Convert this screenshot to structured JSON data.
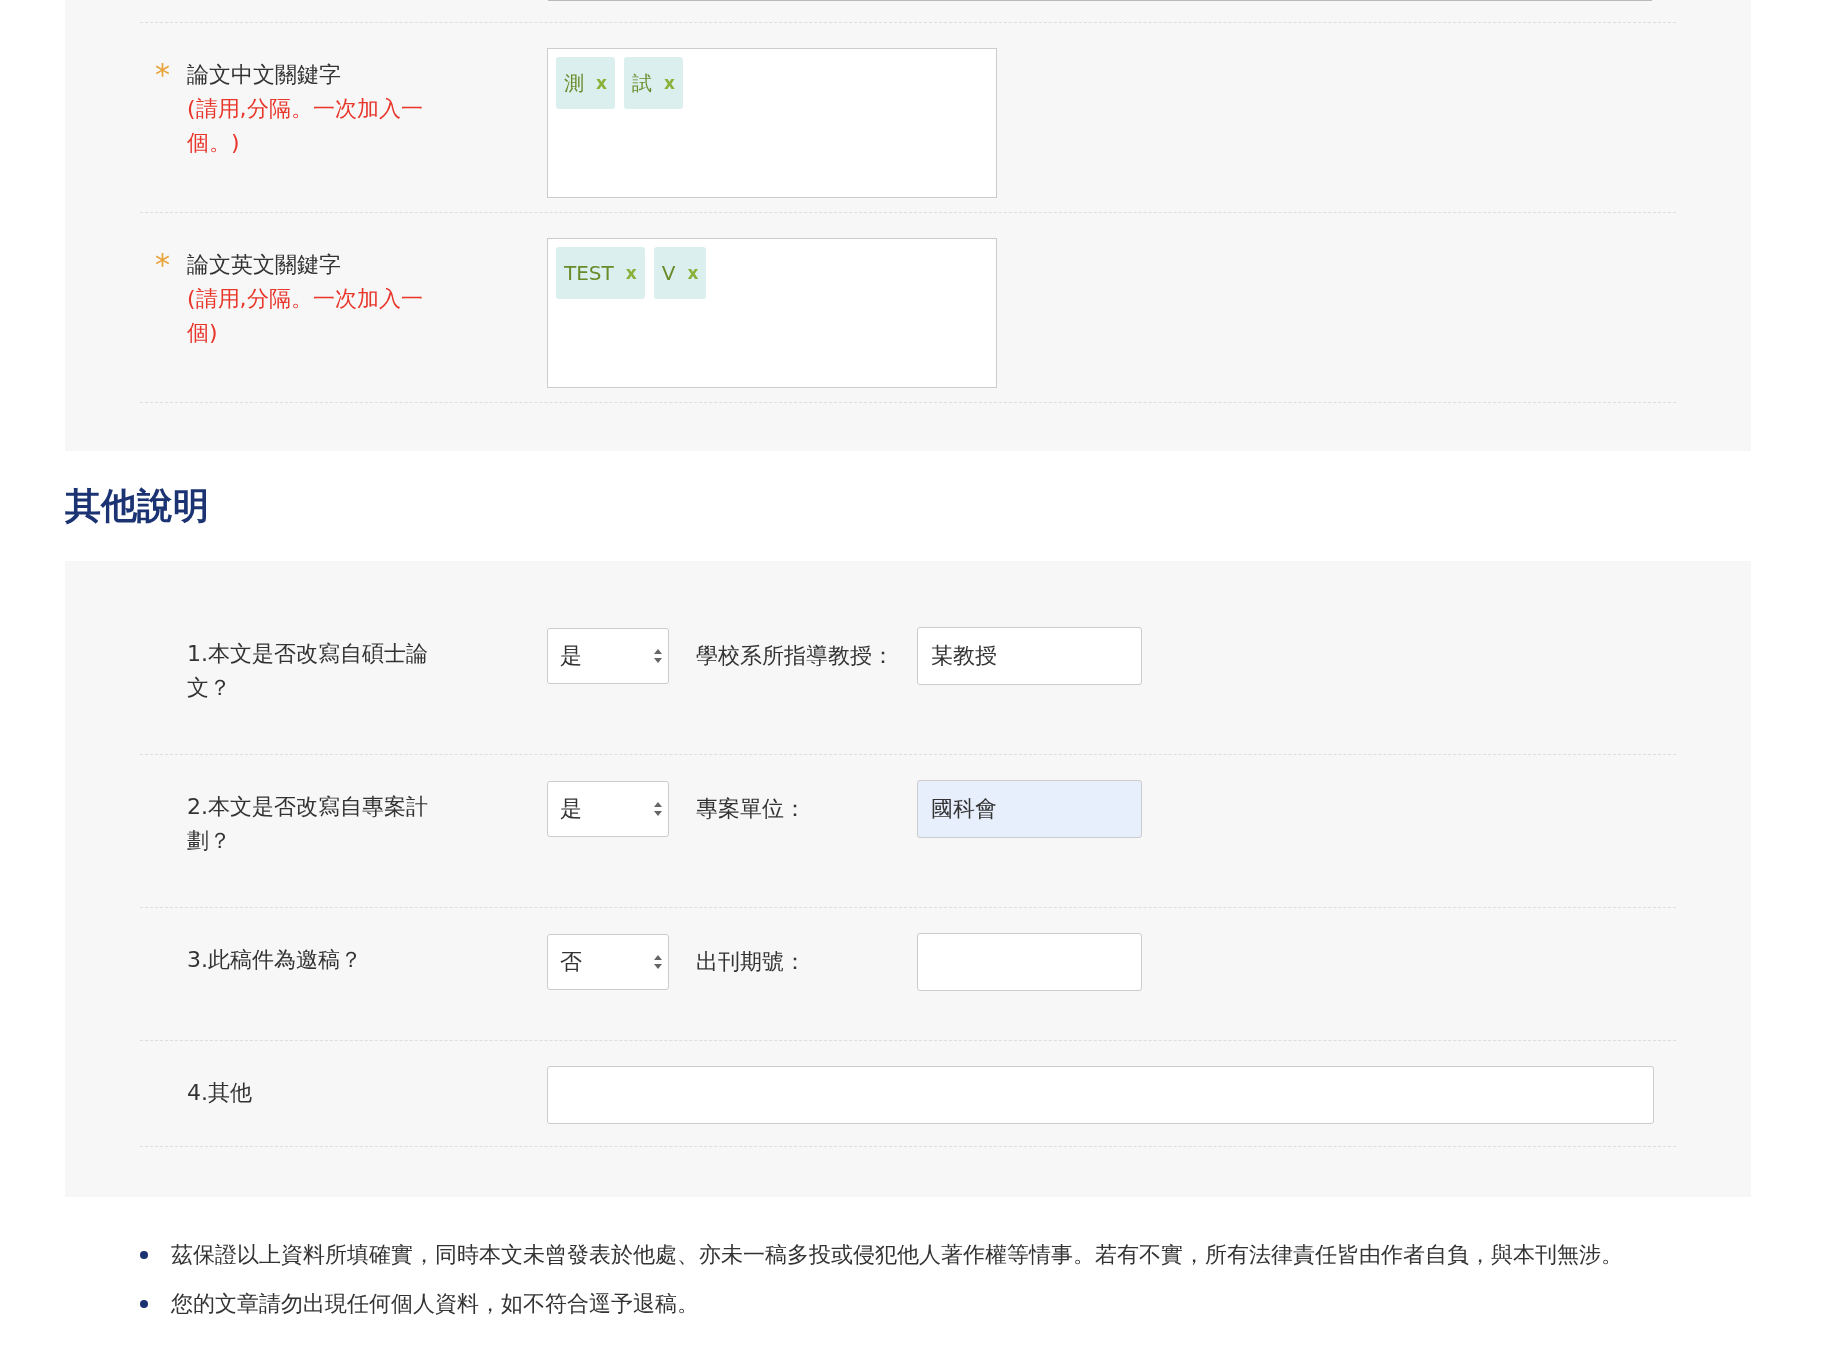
{
  "keyword_rows": [
    {
      "required": true,
      "required_mark": "*",
      "label": "論文中文關鍵字",
      "hint": "(請用,分隔。一次加入一個。)",
      "tags": [
        {
          "text": "測",
          "remove": "x"
        },
        {
          "text": "試",
          "remove": "x"
        }
      ]
    },
    {
      "required": true,
      "required_mark": "*",
      "label": "論文英文關鍵字",
      "hint": "(請用,分隔。一次加入一個)",
      "tags": [
        {
          "text": "TEST",
          "remove": "x"
        },
        {
          "text": "V",
          "remove": "x"
        }
      ]
    }
  ],
  "section_title": "其他說明",
  "question_rows": [
    {
      "kind": "select_input",
      "question": "1.本文是否改寫自碩士論文？",
      "select_value": "是",
      "field_label": "學校系所指導教授：",
      "field_value": "某教授",
      "highlighted": false
    },
    {
      "kind": "select_input",
      "question": "2.本文是否改寫自專案計劃？",
      "select_value": "是",
      "field_label": "專案單位：",
      "field_value": "國科會",
      "highlighted": true
    },
    {
      "kind": "select_input",
      "question": "3.此稿件為邀稿？",
      "select_value": "否",
      "field_label": "出刊期號：",
      "highlighted": false
    },
    {
      "kind": "wide_input",
      "question": "4.其他"
    }
  ],
  "notes": [
    "茲保證以上資料所填確實，同時本文未曾發表於他處、亦未一稿多投或侵犯他人著作權等情事。若有不實，所有法律責任皆由作者自負，與本刊無涉。",
    "您的文章請勿出現任何個人資料，如不符合逕予退稿。"
  ]
}
